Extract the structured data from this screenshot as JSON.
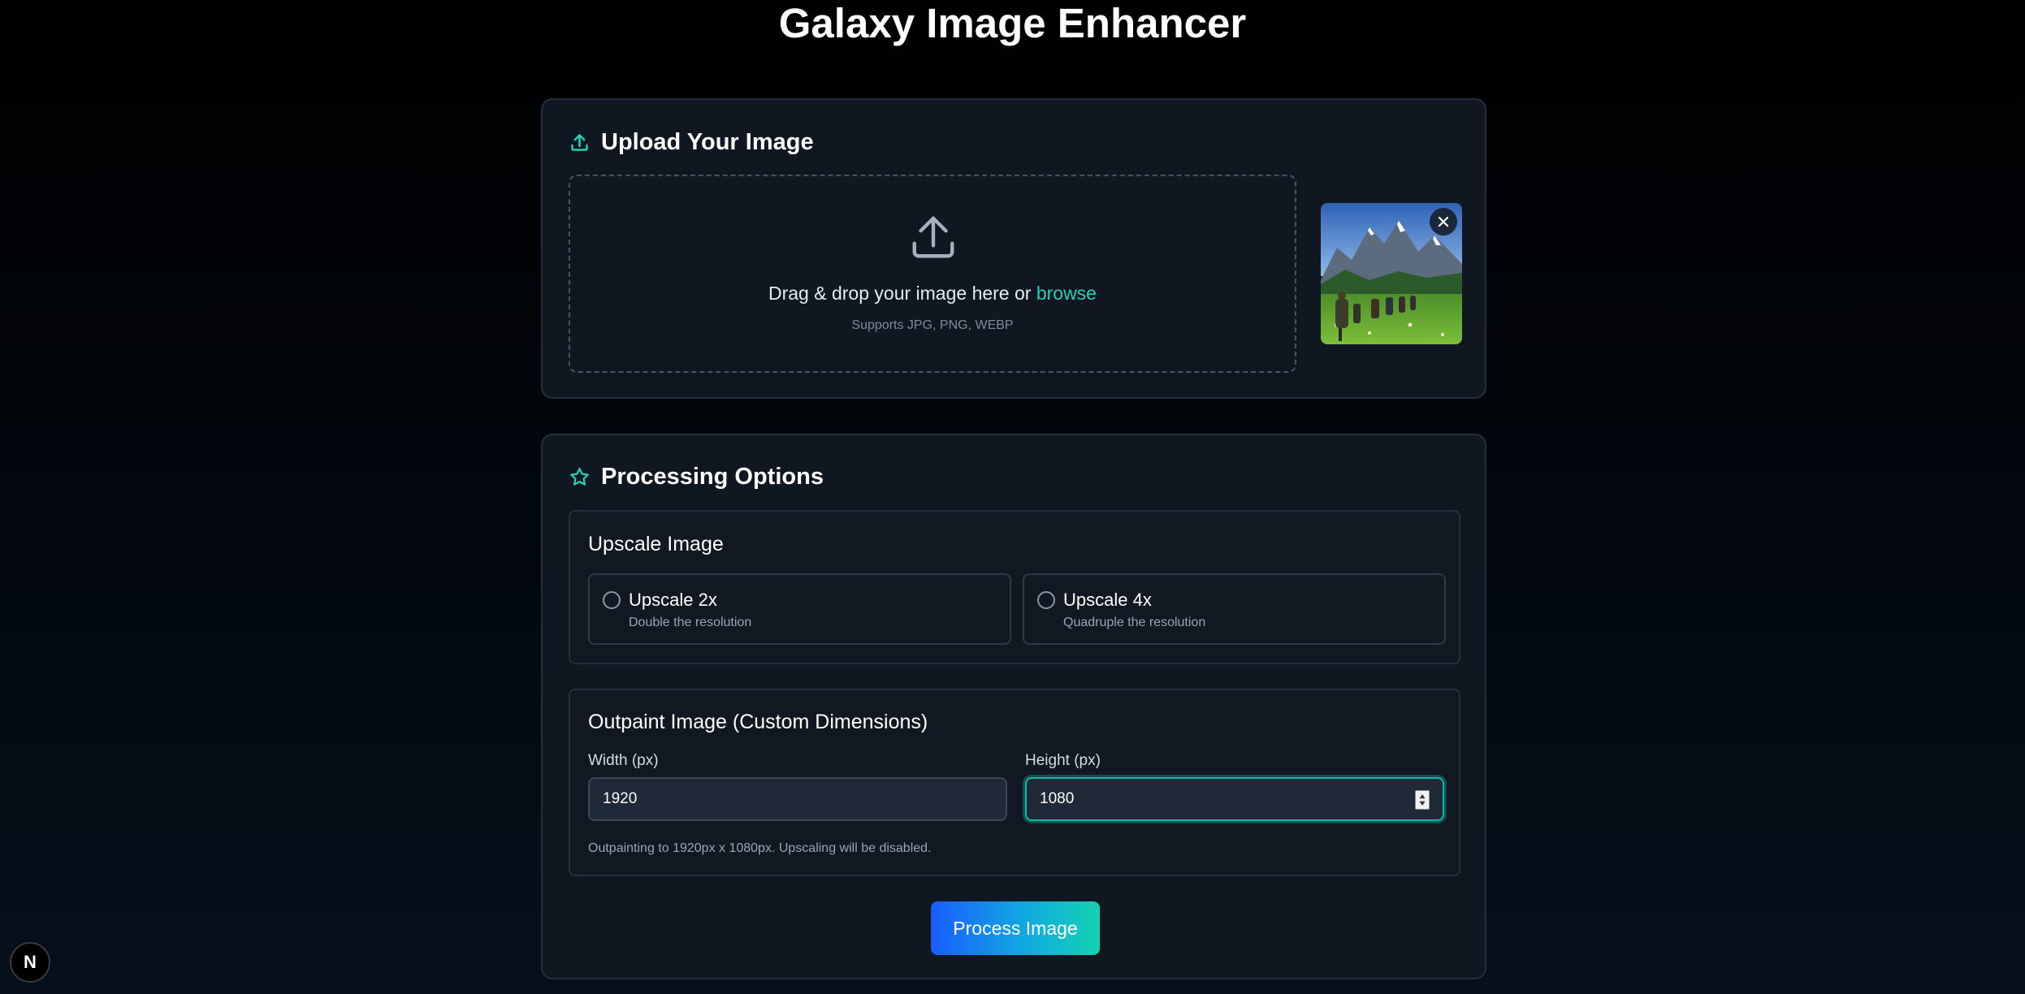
{
  "app": {
    "title": "Galaxy Image Enhancer"
  },
  "upload": {
    "title": "Upload Your Image",
    "dropzone": {
      "prompt": "Drag & drop your image here or",
      "browse_label": "browse",
      "supported": "Supports JPG, PNG, WEBP"
    },
    "preview": {
      "image": "mountain-hikers-photo",
      "remove_icon": "close-icon"
    }
  },
  "options": {
    "title": "Processing Options",
    "upscale": {
      "title": "Upscale Image",
      "choices": [
        {
          "label": "Upscale 2x",
          "description": "Double the resolution",
          "selected": false
        },
        {
          "label": "Upscale 4x",
          "description": "Quadruple the resolution",
          "selected": false
        }
      ]
    },
    "outpaint": {
      "title": "Outpaint Image (Custom Dimensions)",
      "width": {
        "label": "Width (px)",
        "value": "1920"
      },
      "height": {
        "label": "Height (px)",
        "value": "1080",
        "focused": true
      },
      "note": "Outpainting to 1920px x 1080px. Upscaling will be disabled."
    },
    "process_label": "Process Image"
  },
  "badge": {
    "label": "N"
  },
  "colors": {
    "accent": "#22d3b3",
    "background": "#000000",
    "card": "#101720",
    "button_gradient_start": "#1a5cff",
    "button_gradient_end": "#15d2b2"
  },
  "icons": {
    "upload_title": "upload-icon",
    "dropzone": "upload-arrow-icon",
    "options_title": "star-icon"
  }
}
